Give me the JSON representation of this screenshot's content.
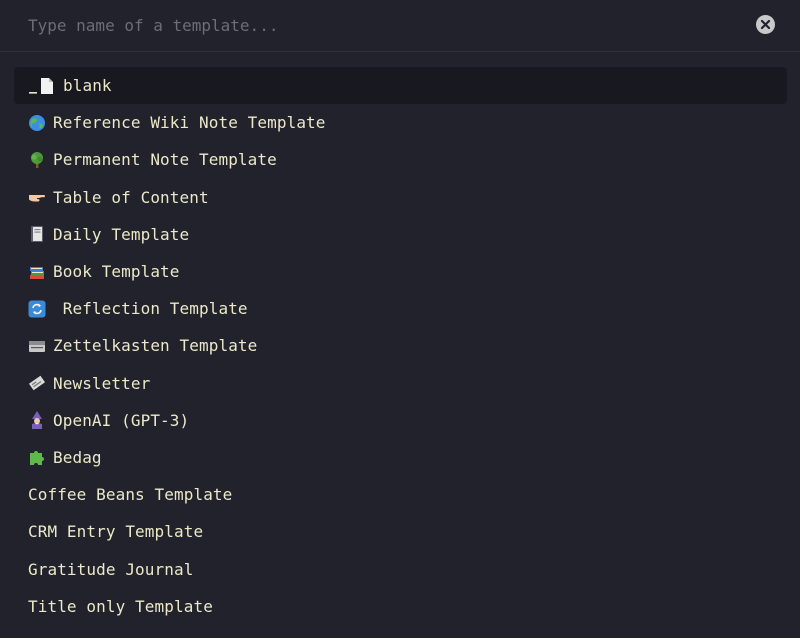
{
  "search": {
    "placeholder": "Type name of a template...",
    "value": ""
  },
  "colors": {
    "background": "#21222b",
    "selected_row": "#181920",
    "text": "#ece8c8",
    "placeholder": "#6c6d76"
  },
  "templates": [
    {
      "label": "blank",
      "icon": "blank-page-icon",
      "selected": true
    },
    {
      "label": "Reference Wiki Note Template",
      "icon": "globe-icon"
    },
    {
      "label": "Permanent Note Template",
      "icon": "tree-icon"
    },
    {
      "label": "Table of Content",
      "icon": "pointing-hand-icon"
    },
    {
      "label": "Daily Template",
      "icon": "notebook-icon"
    },
    {
      "label": "Book Template",
      "icon": "books-icon"
    },
    {
      "label": " Reflection Template",
      "icon": "repeat-arrows-icon"
    },
    {
      "label": "Zettelkasten Template",
      "icon": "card-box-icon"
    },
    {
      "label": "Newsletter",
      "icon": "newspaper-icon"
    },
    {
      "label": "OpenAI (GPT-3)",
      "icon": "wizard-icon"
    },
    {
      "label": "Bedag",
      "icon": "puzzle-icon"
    },
    {
      "label": "Coffee Beans Template",
      "icon": ""
    },
    {
      "label": "CRM Entry Template",
      "icon": ""
    },
    {
      "label": "Gratitude Journal",
      "icon": ""
    },
    {
      "label": "Title only Template",
      "icon": ""
    }
  ]
}
